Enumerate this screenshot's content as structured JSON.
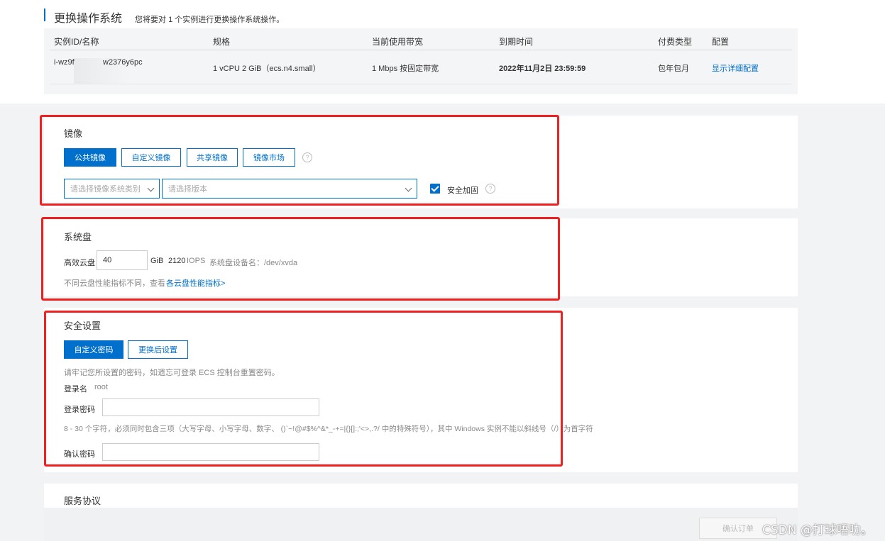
{
  "header": {
    "title": "更换操作系统",
    "subtitle": "您将要对 1 个实例进行更换操作系统操作。"
  },
  "instance_table": {
    "columns": [
      "实例ID/名称",
      "规格",
      "当前使用带宽",
      "到期时间",
      "付费类型",
      "配置"
    ],
    "row": {
      "id_prefix": "i-wz9f",
      "id_suffix": "w2376y6pc",
      "spec": "1 vCPU 2 GiB（ecs.n4.small）",
      "bandwidth": "1 Mbps 按固定带宽",
      "expire": "2022年11月2日 23:59:59",
      "pay_type": "包年包月",
      "config_link": "显示详细配置"
    }
  },
  "image_section": {
    "title": "镜像",
    "tabs": [
      "公共镜像",
      "自定义镜像",
      "共享镜像",
      "镜像市场"
    ],
    "active_tab": 0,
    "type_placeholder": "请选择镜像系统类别",
    "version_placeholder": "请选择版本",
    "security_label": "安全加固",
    "help_icon": "question-circle-icon"
  },
  "disk_section": {
    "title": "系统盘",
    "disk_type": "高效云盘",
    "size_value": "40",
    "unit": "GiB",
    "iops": "2120",
    "iops_unit": "IOPS",
    "device_label": "系统盘设备名：/dev/xvda",
    "note": "不同云盘性能指标不同，查看",
    "note_link": "各云盘性能指标>"
  },
  "security_section": {
    "title": "安全设置",
    "tabs": [
      "自定义密码",
      "更换后设置"
    ],
    "active_tab": 0,
    "hint": "请牢记您所设置的密码，如遗忘可登录 ECS 控制台重置密码。",
    "login_name_label": "登录名",
    "login_name_value": "root",
    "password_label": "登录密码",
    "password_rule": "8 - 30 个字符，必须同时包含三项（大写字母、小写字母、数字、 ()`~!@#$%^&*_-+=|{}[]:;'<>,.?/ 中的特殊符号），其中 Windows 实例不能以斜线号（/）为首字符",
    "confirm_label": "确认密码"
  },
  "agreement_section": {
    "title": "服务协议"
  },
  "footer": {
    "confirm_button": "确认订单",
    "watermark": "CSDN @打球唔叻。"
  },
  "colors": {
    "accent": "#0070cc",
    "highlight_box": "#f02020"
  }
}
